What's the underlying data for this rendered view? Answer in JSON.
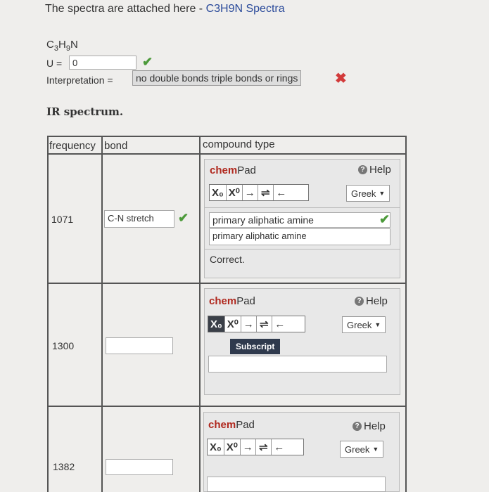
{
  "intro": {
    "prefix": "The spectra are attached here - ",
    "link": "C3H9N Spectra"
  },
  "formula": {
    "c": "C",
    "c_sub": "3",
    "h": "H",
    "h_sub": "9",
    "n": "N"
  },
  "unsaturation": {
    "label": "U =",
    "value": "0"
  },
  "interpretation": {
    "label": "Interpretation =",
    "value": "no double bonds triple bonds or rings"
  },
  "ir_title": "IR spectrum.",
  "table": {
    "headers": {
      "frequency": "frequency",
      "bond": "bond",
      "compound_type": "compound type"
    },
    "rows": [
      {
        "frequency": "1071",
        "bond": "C-N stretch",
        "compound_answer": "primary aliphatic amine",
        "compound_feedback": "primary aliphatic amine",
        "status": "Correct."
      },
      {
        "frequency": "1300",
        "bond": "",
        "compound_answer": "",
        "compound_feedback": "",
        "status": ""
      },
      {
        "frequency": "1382",
        "bond": "",
        "compound_answer": "",
        "compound_feedback": "",
        "status": ""
      }
    ]
  },
  "chempad": {
    "title_bold": "chem",
    "title_rest": "Pad",
    "help": "Help",
    "greek": "Greek",
    "tooltip": "Subscript",
    "buttons": [
      "X₀",
      "X⁰",
      "→",
      "⇌",
      "←"
    ]
  },
  "colors": {
    "check": "#4c9a3a",
    "cross": "#d23a3a",
    "chem": "#b0281e",
    "link": "#2a4a9a"
  }
}
